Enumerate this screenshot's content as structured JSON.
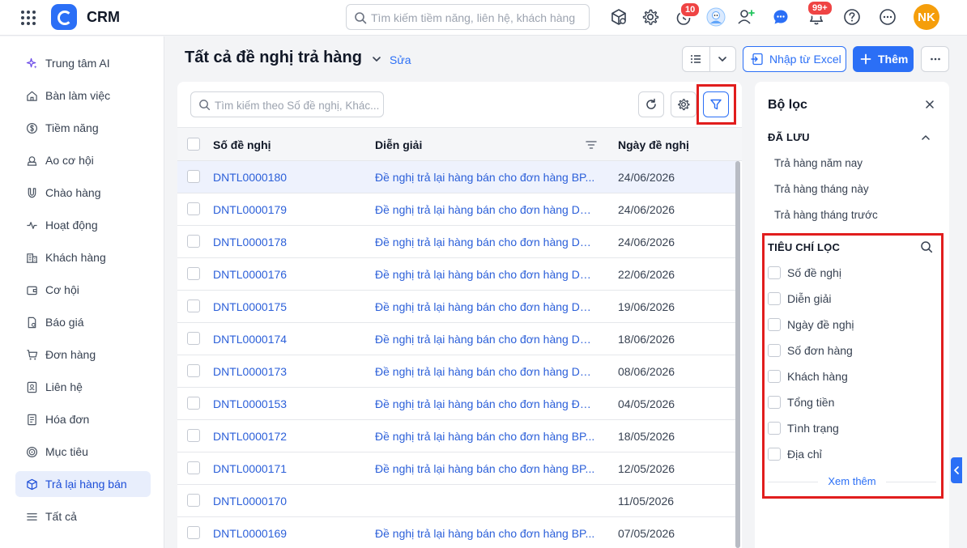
{
  "app": {
    "name": "CRM"
  },
  "topbar": {
    "search_placeholder": "Tìm kiếm tiềm năng, liên hệ, khách hàng",
    "timer_badge": "10",
    "notification_badge": "99+",
    "user_initials": "NK"
  },
  "sidebar": {
    "items": [
      {
        "label": "Trung tâm AI",
        "icon": "sparkle-icon"
      },
      {
        "label": "Bàn làm việc",
        "icon": "home-icon"
      },
      {
        "label": "Tiềm năng",
        "icon": "dollar-circle-icon"
      },
      {
        "label": "Ao cơ hội",
        "icon": "droplet-icon"
      },
      {
        "label": "Chào hàng",
        "icon": "magnet-icon"
      },
      {
        "label": "Hoạt động",
        "icon": "activity-icon"
      },
      {
        "label": "Khách hàng",
        "icon": "building-icon"
      },
      {
        "label": "Cơ hội",
        "icon": "wallet-icon"
      },
      {
        "label": "Báo giá",
        "icon": "quote-doc-icon"
      },
      {
        "label": "Đơn hàng",
        "icon": "cart-icon"
      },
      {
        "label": "Liên hệ",
        "icon": "contact-icon"
      },
      {
        "label": "Hóa đơn",
        "icon": "invoice-icon"
      },
      {
        "label": "Mục tiêu",
        "icon": "target-icon"
      },
      {
        "label": "Trả lại hàng bán",
        "icon": "return-box-icon",
        "active": true
      },
      {
        "label": "Tất cả",
        "icon": "menu-icon"
      }
    ]
  },
  "header": {
    "title": "Tất cả đề nghị trả hàng",
    "edit_label": "Sửa",
    "import_label": "Nhập từ Excel",
    "add_label": "Thêm"
  },
  "list": {
    "search_placeholder": "Tìm kiếm theo Số đề nghị, Khác...",
    "columns": {
      "code": "Số đề nghị",
      "desc": "Diễn giải",
      "date": "Ngày đề nghị"
    },
    "rows": [
      {
        "code": "DNTL0000180",
        "desc": "Đề nghị trả lại hàng bán cho đơn hàng BP...",
        "date": "24/06/2026",
        "selected": true
      },
      {
        "code": "DNTL0000179",
        "desc": "Đề nghị trả lại hàng bán cho đơn hàng DH...",
        "date": "24/06/2026"
      },
      {
        "code": "DNTL0000178",
        "desc": "Đề nghị trả lại hàng bán cho đơn hàng DH...",
        "date": "24/06/2026"
      },
      {
        "code": "DNTL0000176",
        "desc": "Đề nghị trả lại hàng bán cho đơn hàng DH...",
        "date": "22/06/2026"
      },
      {
        "code": "DNTL0000175",
        "desc": "Đề nghị trả lại hàng bán cho đơn hàng DH...",
        "date": "19/06/2026"
      },
      {
        "code": "DNTL0000174",
        "desc": "Đề nghị trả lại hàng bán cho đơn hàng DH...",
        "date": "18/06/2026"
      },
      {
        "code": "DNTL0000173",
        "desc": "Đề nghị trả lại hàng bán cho đơn hàng DH...",
        "date": "08/06/2026"
      },
      {
        "code": "DNTL0000153",
        "desc": "Đề nghị trả lại hàng bán cho đơn hàng ĐH...",
        "date": "04/05/2026"
      },
      {
        "code": "DNTL0000172",
        "desc": "Đề nghị trả lại hàng bán cho đơn hàng BP...",
        "date": "18/05/2026"
      },
      {
        "code": "DNTL0000171",
        "desc": "Đề nghị trả lại hàng bán cho đơn hàng BP...",
        "date": "12/05/2026"
      },
      {
        "code": "DNTL0000170",
        "desc": "",
        "date": "11/05/2026"
      },
      {
        "code": "DNTL0000169",
        "desc": "Đề nghị trả lại hàng bán cho đơn hàng BP...",
        "date": "07/05/2026"
      }
    ]
  },
  "filter_panel": {
    "title": "Bộ lọc",
    "saved_title": "ĐÃ LƯU",
    "saved_items": [
      "Trả hàng năm nay",
      "Trả hàng tháng này",
      "Trả hàng tháng trước"
    ],
    "criteria_title": "TIÊU CHÍ LỌC",
    "criteria": [
      "Số đề nghị",
      "Diễn giải",
      "Ngày đề nghị",
      "Số đơn hàng",
      "Khách hàng",
      "Tổng tiền",
      "Tình trạng",
      "Địa chỉ"
    ],
    "see_more": "Xem thêm"
  },
  "colors": {
    "accent": "#2b6ff6",
    "highlight": "#e11d1d",
    "badge": "#ef4444",
    "avatar": "#f59e0b"
  }
}
